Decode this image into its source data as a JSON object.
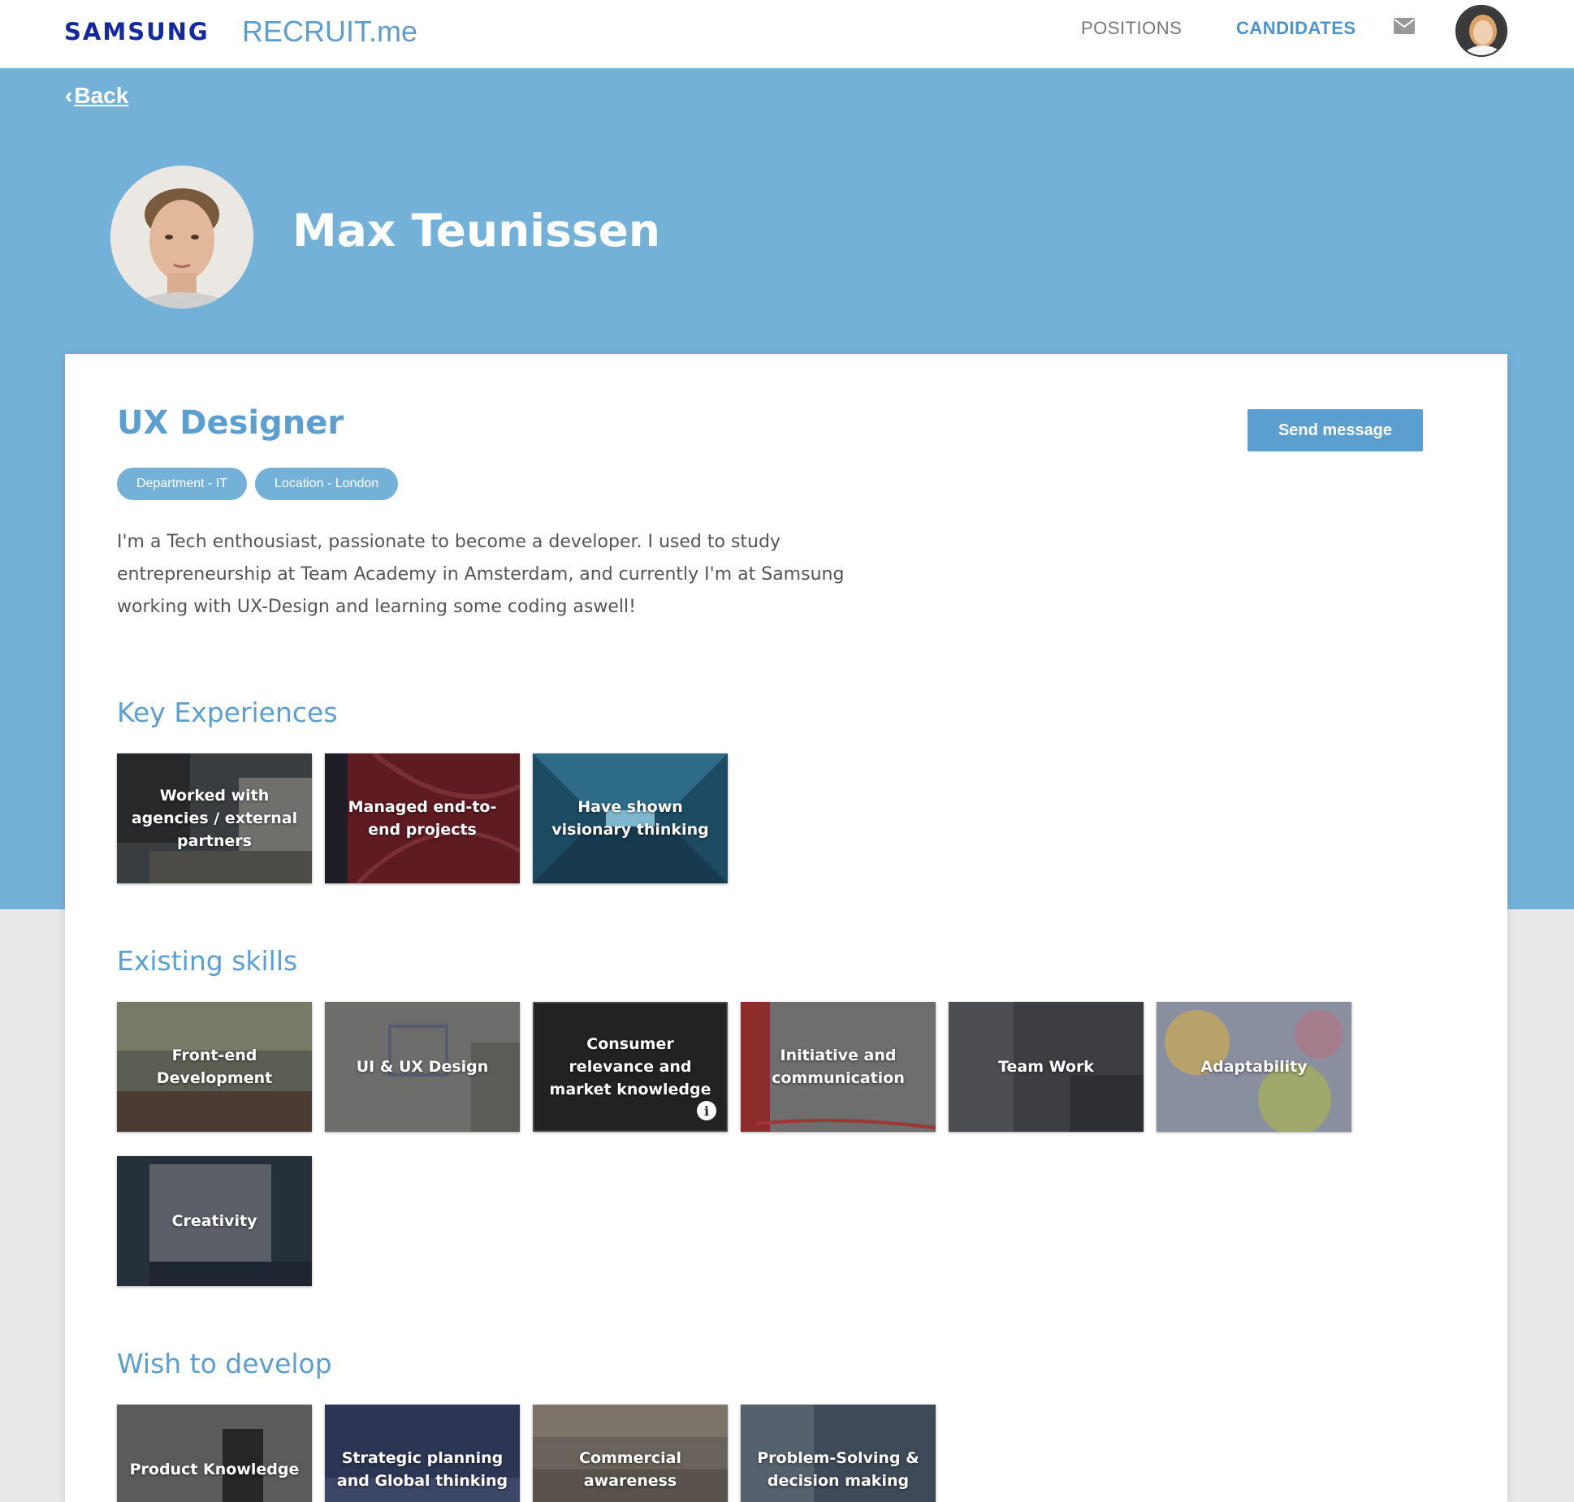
{
  "header": {
    "brand": "SAMSUNG",
    "app_name": "RECRUIT.me",
    "nav": {
      "positions": "POSITIONS",
      "candidates": "CANDIDATES"
    },
    "icons": {
      "mail": "mail-icon",
      "avatar": "user-avatar"
    }
  },
  "back_label": "Back",
  "profile": {
    "name": "Max Teunissen",
    "role": "UX Designer",
    "send_message": "Send message",
    "tags": [
      "Department - IT",
      "Location - London"
    ],
    "bio": "I'm a Tech enthousiast, passionate to become a developer. I used to study entrepreneurship at Team Academy in Amsterdam, and currently I'm at Samsung working with UX-Design and learning some coding aswell!"
  },
  "sections": {
    "key_experiences": {
      "title": "Key Experiences",
      "items": [
        "Worked with agencies / external partners",
        "Managed end-to-end projects",
        "Have shown visionary thinking"
      ]
    },
    "existing_skills": {
      "title": "Existing skills",
      "items": [
        "Front-end Development",
        "UI & UX Design",
        "Consumer relevance and market knowledge",
        "Initiative and communication",
        "Team Work",
        "Adaptability",
        "Creativity"
      ]
    },
    "wish_to_develop": {
      "title": "Wish to develop",
      "items": [
        "Product Knowledge",
        "Strategic planning and Global thinking",
        "Commercial awareness",
        "Problem-Solving & decision making"
      ]
    }
  },
  "colors": {
    "brand_blue": "#1428a0",
    "accent": "#5a9fd0",
    "hero_bg": "#74b1d9",
    "page_bg": "#e8e8e8"
  }
}
